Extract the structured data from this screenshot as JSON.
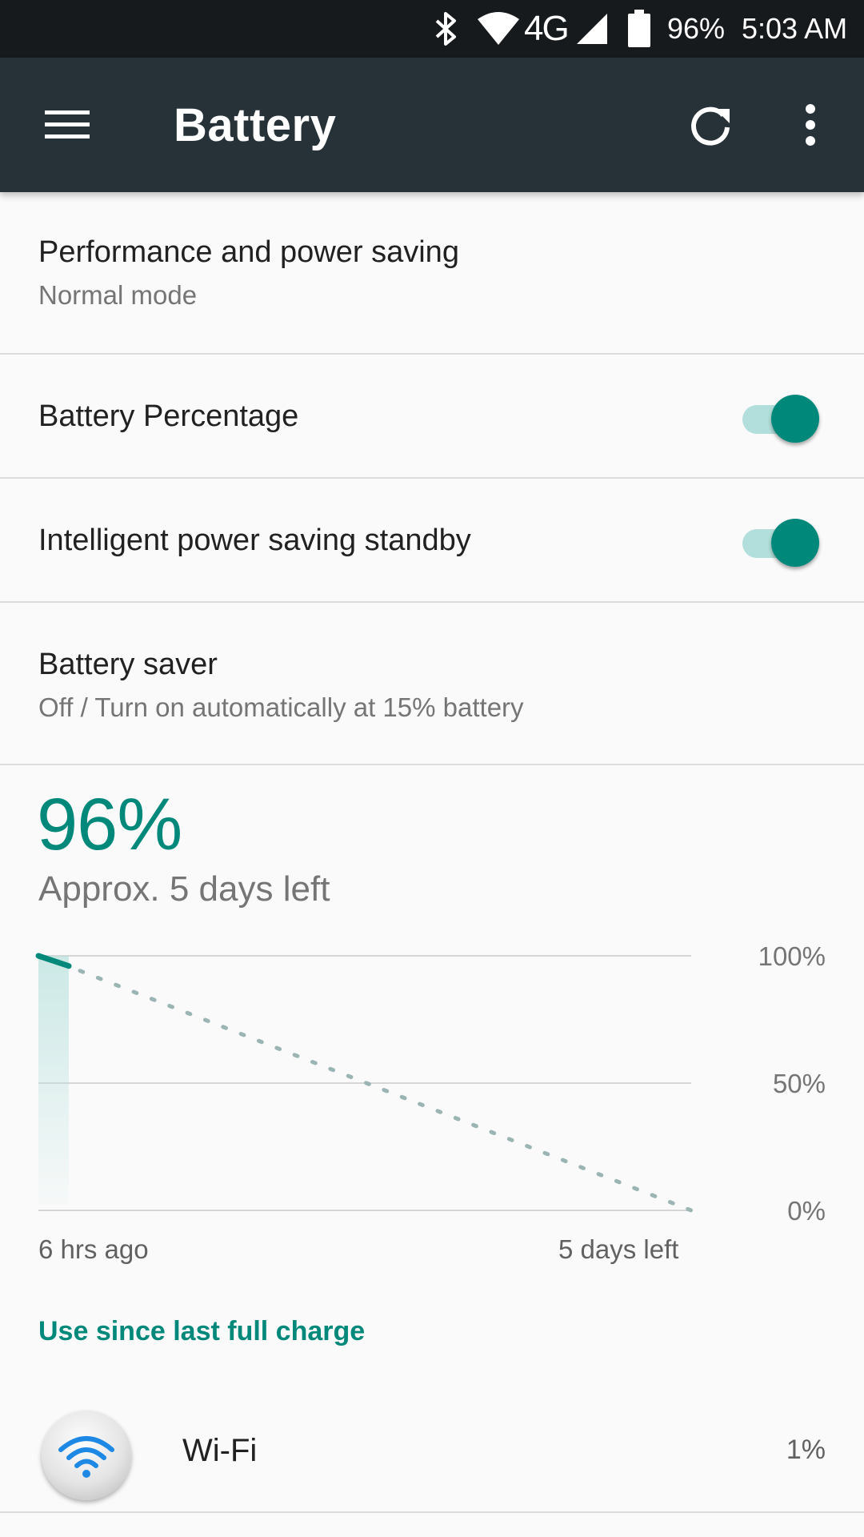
{
  "status_bar": {
    "network": "4G",
    "battery": "96%",
    "time": "5:03 AM",
    "icons": [
      "bluetooth-icon",
      "wifi-icon",
      "signal-icon",
      "battery-icon"
    ]
  },
  "app_bar": {
    "title": "Battery",
    "icons": [
      "menu-icon",
      "refresh-icon",
      "more-vert-icon"
    ]
  },
  "settings": [
    {
      "title": "Performance and power saving",
      "subtitle": "Normal mode"
    },
    {
      "title": "Battery Percentage",
      "toggle": true
    },
    {
      "title": "Intelligent power saving standby",
      "toggle": true
    },
    {
      "title": "Battery saver",
      "subtitle": "Off / Turn on automatically at 15% battery"
    }
  ],
  "battery": {
    "percent": "96%",
    "time_left": "Approx. 5 days left"
  },
  "chart_data": {
    "type": "line",
    "x_labels": [
      "6 hrs ago",
      "5 days left"
    ],
    "y_ticks": [
      "100%",
      "50%",
      "0%"
    ],
    "ylim": [
      0,
      100
    ],
    "series": [
      {
        "values": [
          100,
          96
        ]
      },
      {
        "values": [
          96,
          0
        ]
      }
    ],
    "colors": {
      "history": "#00897b",
      "projection": "#9ab5b3",
      "fill": "#b2dfdb"
    }
  },
  "usage": {
    "header": "Use since last full charge",
    "items": [
      {
        "name": "Wi-Fi",
        "percent": "1%",
        "icon": "wifi-icon"
      }
    ]
  },
  "colors": {
    "accent": "#00897b",
    "app_bar": "#263238",
    "status_bar": "#161a1d"
  }
}
